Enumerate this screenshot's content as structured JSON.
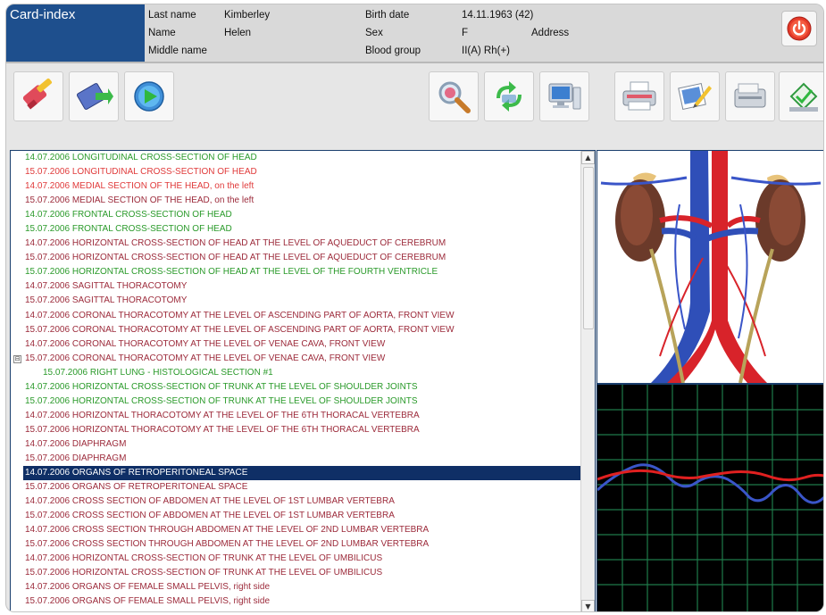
{
  "app": {
    "title": "Card-index"
  },
  "patient": {
    "last_name_label": "Last name",
    "last_name": "Kimberley",
    "name_label": "Name",
    "name": "Helen",
    "middle_name_label": "Middle name",
    "middle_name": "",
    "birth_date_label": "Birth date",
    "birth_date": "14.11.1963 (42)",
    "sex_label": "Sex",
    "sex": "F",
    "address_label": "Address",
    "blood_group_label": "Blood group",
    "blood_group": "II(A) Rh(+)"
  },
  "toolbar": {
    "left_buttons": [
      "edit-pencil-icon",
      "film-arrow-icon",
      "play-icon"
    ],
    "right_buttons": [
      "magnifier-icon",
      "recycle-icon",
      "computer-icon",
      "printer-icon",
      "image-edit-icon",
      "scanner-icon",
      "save-icon"
    ]
  },
  "records": [
    {
      "date": "14.07.2006",
      "title": "LONGITUDINAL CROSS-SECTION OF HEAD",
      "color": "green"
    },
    {
      "date": "15.07.2006",
      "title": "LONGITUDINAL CROSS-SECTION OF HEAD",
      "color": "red"
    },
    {
      "date": "14.07.2006",
      "title": "MEDIAL SECTION OF THE HEAD, on the left",
      "color": "red"
    },
    {
      "date": "15.07.2006",
      "title": "MEDIAL SECTION OF THE HEAD, on the left",
      "color": "maroon"
    },
    {
      "date": "14.07.2006",
      "title": "FRONTAL CROSS-SECTION OF HEAD",
      "color": "green"
    },
    {
      "date": "15.07.2006",
      "title": "FRONTAL CROSS-SECTION OF HEAD",
      "color": "green"
    },
    {
      "date": "14.07.2006",
      "title": "HORIZONTAL CROSS-SECTION OF HEAD AT THE LEVEL OF AQUEDUCT OF CEREBRUM",
      "color": "maroon"
    },
    {
      "date": "15.07.2006",
      "title": "HORIZONTAL CROSS-SECTION OF HEAD AT THE LEVEL OF AQUEDUCT OF CEREBRUM",
      "color": "maroon"
    },
    {
      "date": "15.07.2006",
      "title": "HORIZONTAL CROSS-SECTION OF HEAD AT THE LEVEL OF THE FOURTH VENTRICLE",
      "color": "green"
    },
    {
      "date": "14.07.2006",
      "title": "SAGITTAL THORACOTOMY",
      "color": "maroon"
    },
    {
      "date": "15.07.2006",
      "title": "SAGITTAL THORACOTOMY",
      "color": "maroon"
    },
    {
      "date": "14.07.2006",
      "title": "CORONAL THORACOTOMY AT THE LEVEL OF ASCENDING PART OF AORTA, FRONT VIEW",
      "color": "maroon"
    },
    {
      "date": "15.07.2006",
      "title": "CORONAL THORACOTOMY AT THE LEVEL OF ASCENDING PART OF AORTA, FRONT VIEW",
      "color": "maroon"
    },
    {
      "date": "14.07.2006",
      "title": "CORONAL THORACOTOMY AT THE LEVEL OF VENAE CAVA, FRONT VIEW",
      "color": "maroon"
    },
    {
      "date": "15.07.2006",
      "title": "CORONAL THORACOTOMY AT THE LEVEL OF VENAE CAVA, FRONT VIEW",
      "color": "maroon",
      "toggle": "⊟"
    },
    {
      "date": "15.07.2006",
      "title": "RIGHT LUNG - HISTOLOGICAL SECTION #1",
      "color": "green",
      "child": true
    },
    {
      "date": "14.07.2006",
      "title": "HORIZONTAL CROSS-SECTION OF TRUNK AT THE LEVEL OF SHOULDER JOINTS",
      "color": "green"
    },
    {
      "date": "15.07.2006",
      "title": "HORIZONTAL CROSS-SECTION OF TRUNK AT THE LEVEL OF SHOULDER JOINTS",
      "color": "green"
    },
    {
      "date": "14.07.2006",
      "title": "HORIZONTAL THORACOTOMY AT THE LEVEL OF THE 6TH THORACAL VERTEBRA",
      "color": "maroon"
    },
    {
      "date": "15.07.2006",
      "title": "HORIZONTAL THORACOTOMY AT THE LEVEL OF THE 6TH THORACAL VERTEBRA",
      "color": "maroon"
    },
    {
      "date": "14.07.2006",
      "title": "DIAPHRAGM",
      "color": "maroon"
    },
    {
      "date": "15.07.2006",
      "title": "DIAPHRAGM",
      "color": "maroon"
    },
    {
      "date": "14.07.2006",
      "title": "ORGANS OF RETROPERITONEAL SPACE",
      "color": "selected"
    },
    {
      "date": "15.07.2006",
      "title": "ORGANS OF RETROPERITONEAL SPACE",
      "color": "maroon"
    },
    {
      "date": "14.07.2006",
      "title": "CROSS SECTION OF ABDOMEN AT THE LEVEL OF 1ST LUMBAR VERTEBRA",
      "color": "maroon"
    },
    {
      "date": "15.07.2006",
      "title": "CROSS SECTION OF ABDOMEN AT THE LEVEL OF 1ST LUMBAR VERTEBRA",
      "color": "maroon"
    },
    {
      "date": "14.07.2006",
      "title": "CROSS SECTION THROUGH ABDOMEN AT THE LEVEL OF 2ND LUMBAR VERTEBRA",
      "color": "maroon"
    },
    {
      "date": "15.07.2006",
      "title": "CROSS SECTION THROUGH ABDOMEN AT THE LEVEL OF 2ND LUMBAR VERTEBRA",
      "color": "maroon"
    },
    {
      "date": "14.07.2006",
      "title": "HORIZONTAL CROSS-SECTION OF TRUNK AT THE LEVEL OF UMBILICUS",
      "color": "maroon"
    },
    {
      "date": "15.07.2006",
      "title": "HORIZONTAL CROSS-SECTION OF TRUNK AT THE LEVEL OF UMBILICUS",
      "color": "maroon"
    },
    {
      "date": "14.07.2006",
      "title": "ORGANS OF FEMALE SMALL PELVIS, right side",
      "color": "maroon"
    },
    {
      "date": "15.07.2006",
      "title": "ORGANS OF FEMALE SMALL PELVIS, right side",
      "color": "maroon"
    }
  ],
  "colors": {
    "accent": "#1e4f8d",
    "selected_row": "#0f2f66",
    "green_text": "#2a9a2a",
    "red_text": "#e03a3a",
    "maroon_text": "#9c2a3a",
    "graph_grid": "#1f7a4a",
    "graph_red": "#e02020",
    "graph_blue": "#3a55c8"
  }
}
